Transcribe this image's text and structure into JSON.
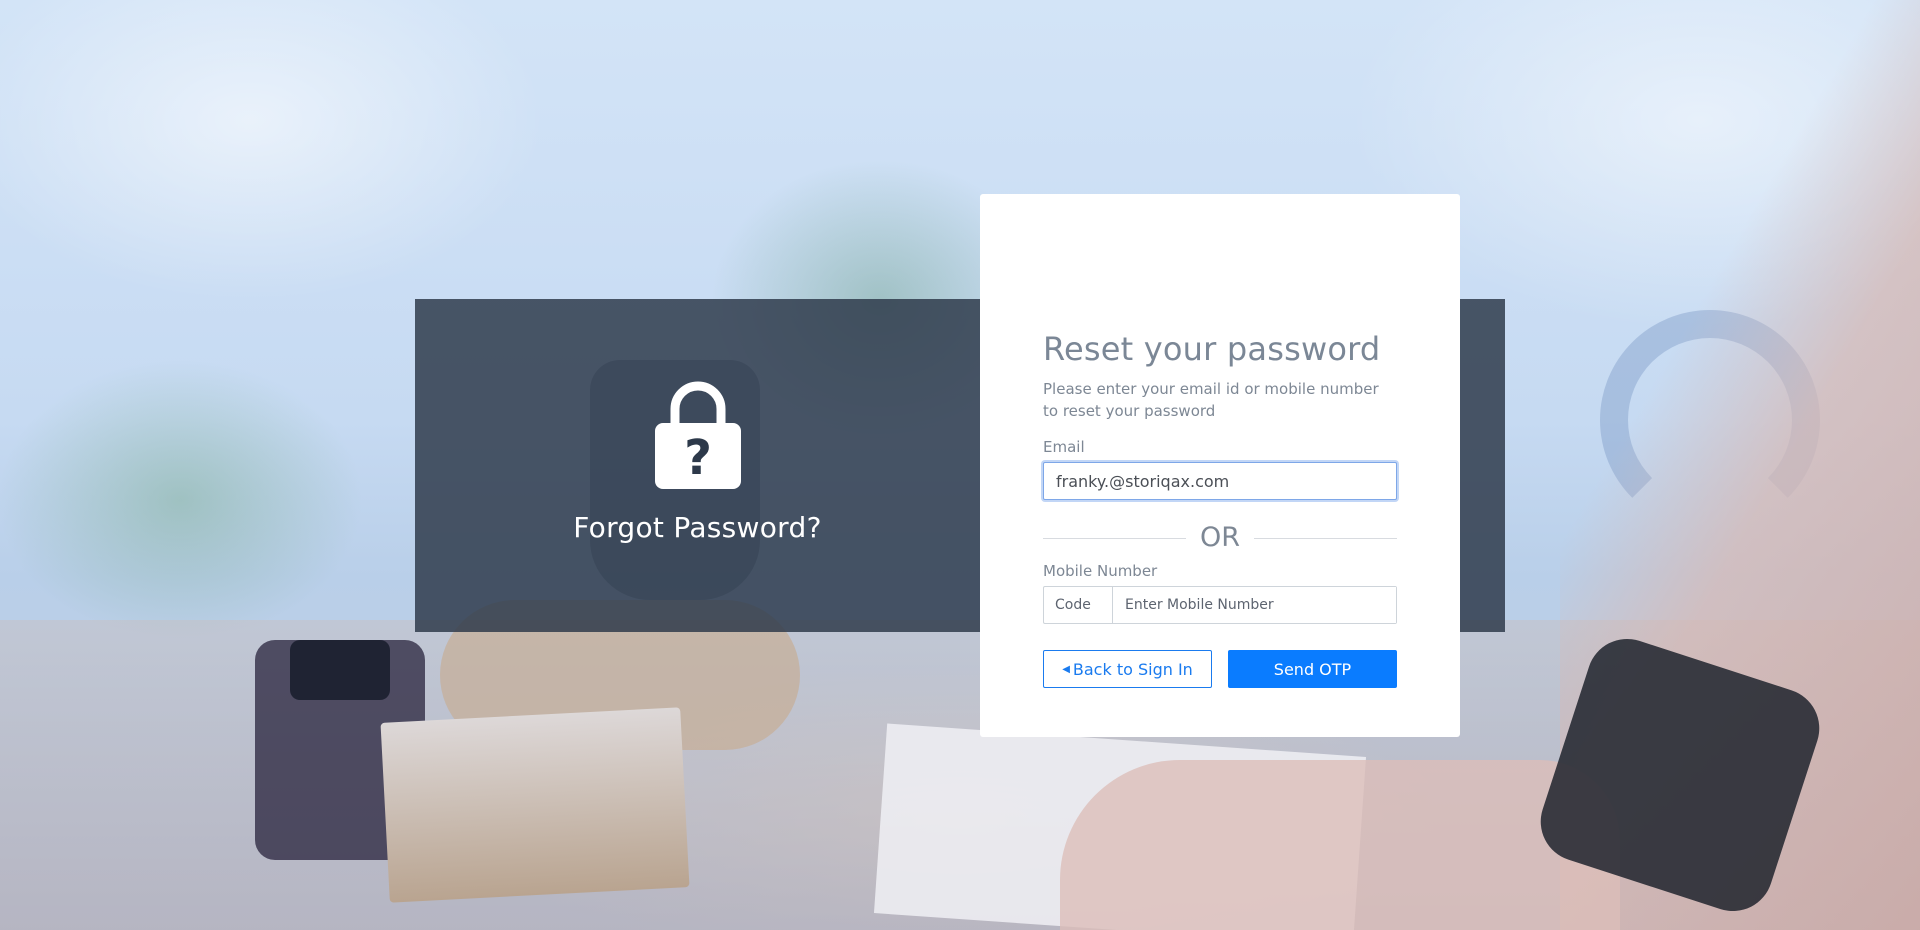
{
  "left_panel": {
    "title": "Forgot Password?",
    "icon": "lock-question-icon"
  },
  "card": {
    "title": "Reset your password",
    "subtitle": "Please enter your email id or mobile number to reset your password",
    "email": {
      "label": "Email",
      "value": "franky.@storiqax.com"
    },
    "separator": "OR",
    "mobile": {
      "label": "Mobile Number",
      "code_label": "Code",
      "placeholder": "Enter Mobile Number"
    },
    "buttons": {
      "back_label": "Back to Sign In",
      "back_icon": "caret-left-icon",
      "send_label": "Send OTP"
    }
  },
  "colors": {
    "band": "#2d394a",
    "accent": "#0a7cff",
    "text_muted": "#7d8794"
  }
}
